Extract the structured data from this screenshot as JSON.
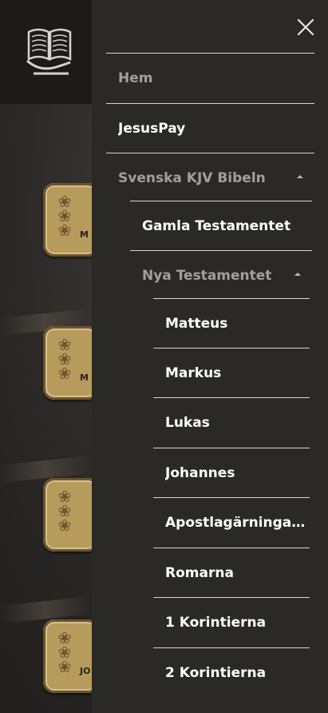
{
  "background": {
    "book_cards": [
      {
        "abbr": "M"
      },
      {
        "abbr": "M"
      },
      {
        "abbr": ""
      },
      {
        "abbr": "JO"
      }
    ]
  },
  "drawer": {
    "close_icon": "close-x-icon",
    "items": [
      {
        "label": "Hem",
        "level": 0
      },
      {
        "label": "JesusPay",
        "level": 0
      },
      {
        "label": "Svenska KJV Bibeln",
        "level": 0,
        "expanded": true
      },
      {
        "label": "Gamla Testamentet",
        "level": 1
      },
      {
        "label": "Nya Testamentet",
        "level": 1,
        "expanded": true
      },
      {
        "label": "Matteus",
        "level": 2
      },
      {
        "label": "Markus",
        "level": 2
      },
      {
        "label": "Lukas",
        "level": 2
      },
      {
        "label": "Johannes",
        "level": 2
      },
      {
        "label": "Apostlagärningarna",
        "level": 2
      },
      {
        "label": "Romarna",
        "level": 2
      },
      {
        "label": "1 Korintierna",
        "level": 2
      },
      {
        "label": "2 Korintierna",
        "level": 2
      }
    ]
  },
  "colors": {
    "drawer_bg": "#2b2926",
    "text_active": "#ffffff",
    "text_muted": "#a3a09b",
    "divider": "#d9d6cf",
    "card_gold": "#b79b5d"
  }
}
